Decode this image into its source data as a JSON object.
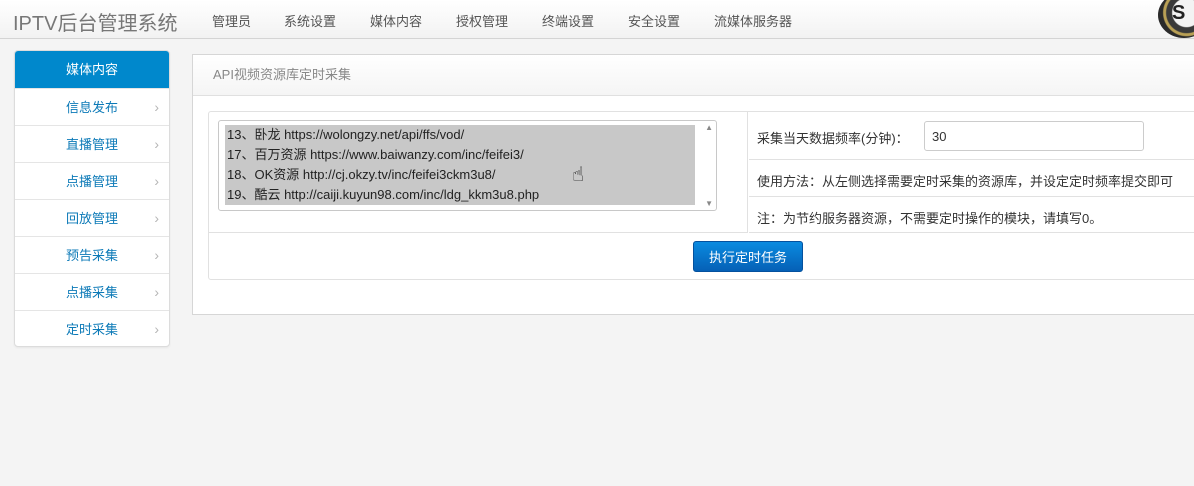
{
  "app": {
    "title": "IPTV后台管理系统"
  },
  "nav": {
    "items": [
      "管理员",
      "系统设置",
      "媒体内容",
      "授权管理",
      "终端设置",
      "安全设置",
      "流媒体服务器"
    ],
    "avatar_letter": "S"
  },
  "sidebar": {
    "header": "媒体内容",
    "items": [
      {
        "label": "信息发布"
      },
      {
        "label": "直播管理"
      },
      {
        "label": "点播管理"
      },
      {
        "label": "回放管理"
      },
      {
        "label": "预告采集"
      },
      {
        "label": "点播采集"
      },
      {
        "label": "定时采集"
      }
    ],
    "chevron": "chevron-right-icon"
  },
  "panel": {
    "title": "API视频资源库定时采集",
    "sources": [
      "13、卧龙 https://wolongzy.net/api/ffs/vod/",
      "17、百万资源 https://www.baiwanzy.com/inc/feifei3/",
      "18、OK资源 http://cj.okzy.tv/inc/feifei3ckm3u8/",
      "19、酷云 http://caiji.kuyun98.com/inc/ldg_kkm3u8.php"
    ],
    "freq_label": "采集当天数据频率(分钟)：",
    "freq_value": "30",
    "usage_text": "使用方法：从左侧选择需要定时采集的资源库，并设定定时频率提交即可",
    "note_text": "注：为节约服务器资源，不需要定时操作的模块，请填写0。",
    "run_button": "执行定时任务"
  },
  "colors": {
    "accent": "#0088cc",
    "button": "#0a6fcb",
    "selection": "#c8c8c8"
  }
}
